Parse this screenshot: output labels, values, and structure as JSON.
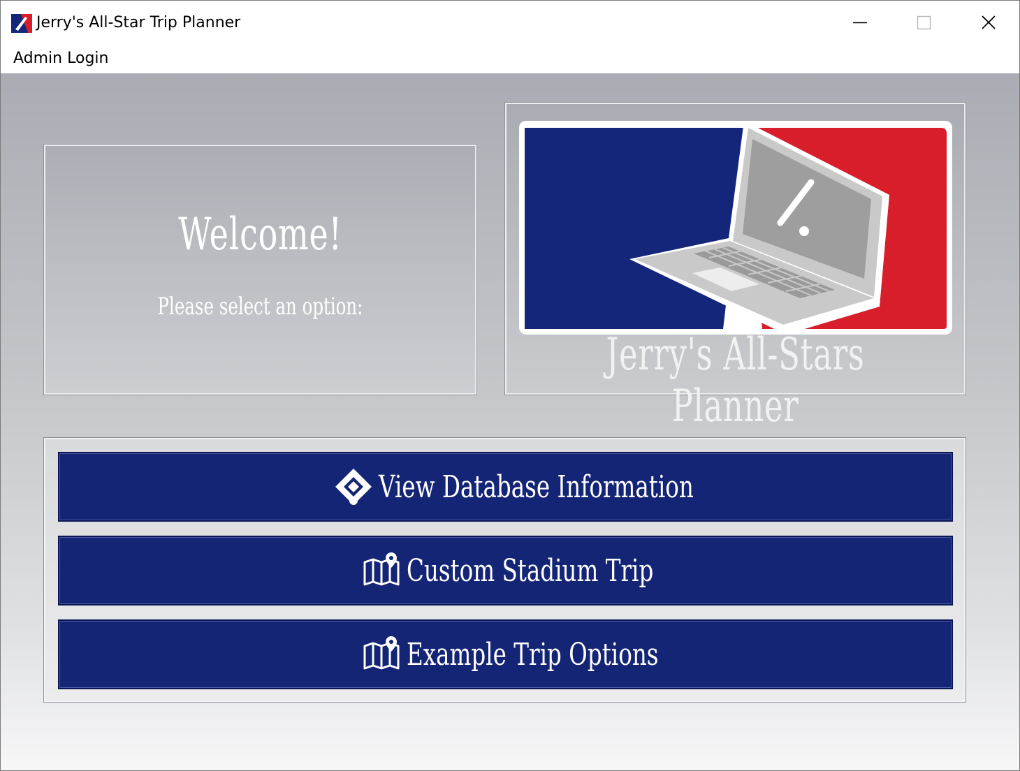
{
  "window": {
    "title": "Jerry's All-Star Trip Planner",
    "controls": [
      "minimize",
      "maximize",
      "close"
    ]
  },
  "menu": {
    "items": [
      {
        "label": "Admin Login"
      }
    ]
  },
  "welcome": {
    "title": "Welcome!",
    "subtitle": "Please select an option:"
  },
  "logo": {
    "caption": "Jerry's All-Stars Planner",
    "colors": {
      "blue": "#13267a",
      "red": "#d81e2b",
      "laptop": "#c6c6c6"
    }
  },
  "actions": [
    {
      "label": "View Database Information",
      "icon": "baseball-diamond-icon"
    },
    {
      "label": "Custom Stadium Trip",
      "icon": "map-pin-icon"
    },
    {
      "label": "Example Trip Options",
      "icon": "map-pin-icon"
    }
  ],
  "colors": {
    "button_bg": "#142576",
    "button_text": "#ffffff"
  }
}
